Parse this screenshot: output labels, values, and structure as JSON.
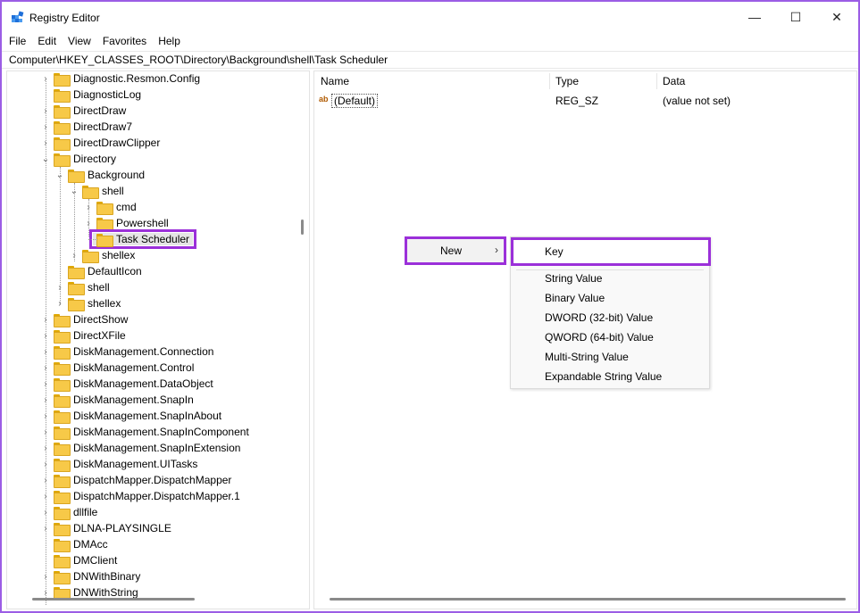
{
  "window": {
    "title": "Registry Editor",
    "minimize": "—",
    "maximize": "☐",
    "close": "✕",
    "border_color": "#9b5de5"
  },
  "menu": [
    "File",
    "Edit",
    "View",
    "Favorites",
    "Help"
  ],
  "address": "Computer\\HKEY_CLASSES_ROOT\\Directory\\Background\\shell\\Task Scheduler",
  "tree": {
    "items": [
      {
        "label": "Diagnostic.Resmon.Config",
        "chevron": "›"
      },
      {
        "label": "DiagnosticLog",
        "chevron": ""
      },
      {
        "label": "DirectDraw",
        "chevron": "›"
      },
      {
        "label": "DirectDraw7",
        "chevron": "›"
      },
      {
        "label": "DirectDrawClipper",
        "chevron": "›"
      },
      {
        "label": "Directory",
        "chevron": "⌄"
      },
      {
        "label": "Background",
        "chevron": "⌄"
      },
      {
        "label": "shell",
        "chevron": "⌄"
      },
      {
        "label": "cmd",
        "chevron": "›"
      },
      {
        "label": "Powershell",
        "chevron": "›"
      },
      {
        "label": "Task Scheduler",
        "chevron": ""
      },
      {
        "label": "shellex",
        "chevron": "›"
      },
      {
        "label": "DefaultIcon",
        "chevron": ""
      },
      {
        "label": "shell",
        "chevron": "›"
      },
      {
        "label": "shellex",
        "chevron": "›"
      },
      {
        "label": "DirectShow",
        "chevron": "›"
      },
      {
        "label": "DirectXFile",
        "chevron": "›"
      },
      {
        "label": "DiskManagement.Connection",
        "chevron": "›"
      },
      {
        "label": "DiskManagement.Control",
        "chevron": "›"
      },
      {
        "label": "DiskManagement.DataObject",
        "chevron": "›"
      },
      {
        "label": "DiskManagement.SnapIn",
        "chevron": "›"
      },
      {
        "label": "DiskManagement.SnapInAbout",
        "chevron": "›"
      },
      {
        "label": "DiskManagement.SnapInComponent",
        "chevron": "›"
      },
      {
        "label": "DiskManagement.SnapInExtension",
        "chevron": "›"
      },
      {
        "label": "DiskManagement.UITasks",
        "chevron": "›"
      },
      {
        "label": "DispatchMapper.DispatchMapper",
        "chevron": "›"
      },
      {
        "label": "DispatchMapper.DispatchMapper.1",
        "chevron": "›"
      },
      {
        "label": "dllfile",
        "chevron": "›"
      },
      {
        "label": "DLNA-PLAYSINGLE",
        "chevron": "›"
      },
      {
        "label": "DMAcc",
        "chevron": ""
      },
      {
        "label": "DMClient",
        "chevron": ""
      },
      {
        "label": "DNWithBinary",
        "chevron": "›"
      },
      {
        "label": "DNWithString",
        "chevron": "›"
      }
    ]
  },
  "list": {
    "columns": [
      "Name",
      "Type",
      "Data"
    ],
    "rows": [
      {
        "icon": "ab",
        "name": "(Default)",
        "type": "REG_SZ",
        "data": "(value not set)"
      }
    ]
  },
  "context_menu": {
    "new_label": "New",
    "new_arrow": "›",
    "submenu": {
      "key": "Key",
      "items": [
        "String Value",
        "Binary Value",
        "DWORD (32-bit) Value",
        "QWORD (64-bit) Value",
        "Multi-String Value",
        "Expandable String Value"
      ]
    }
  },
  "highlight_color": "#9b30d9"
}
